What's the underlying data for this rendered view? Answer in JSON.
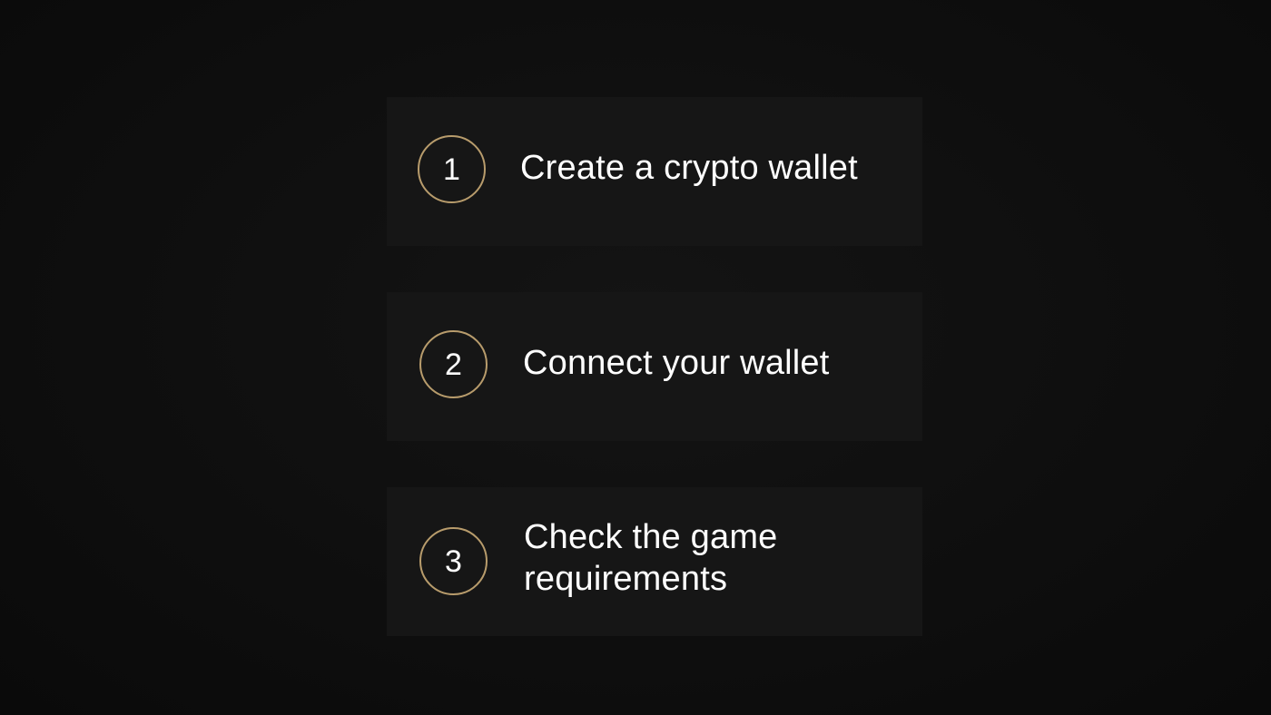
{
  "accent_color": "#b89c6c",
  "steps": [
    {
      "number": "1",
      "label": "Create a crypto wallet"
    },
    {
      "number": "2",
      "label": "Connect your wallet"
    },
    {
      "number": "3",
      "label": "Check the game requirements",
      "line1": "Check the game",
      "line2": "requirements"
    }
  ]
}
